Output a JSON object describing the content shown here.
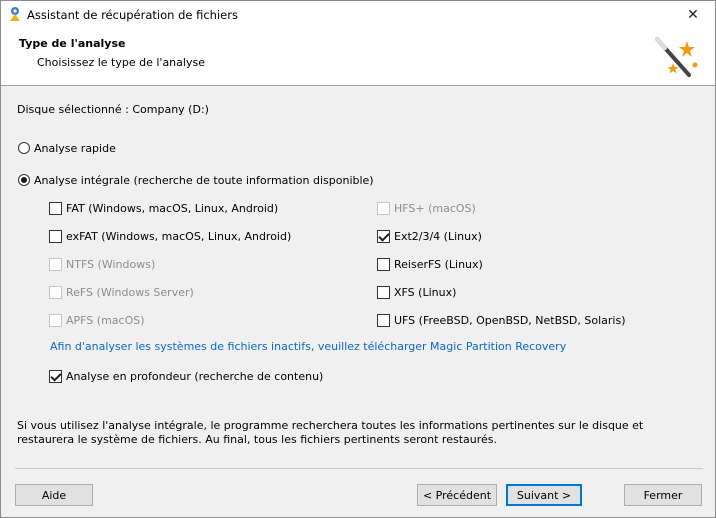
{
  "window": {
    "title": "Assistant de récupération de fichiers",
    "close_glyph": "✕"
  },
  "header": {
    "title": "Type de l'analyse",
    "subtitle": "Choisissez le type de l'analyse"
  },
  "disk": {
    "label": "Disque sélectionné : Company (D:)"
  },
  "scan_options": {
    "quick": {
      "label": "Analyse rapide",
      "selected": false
    },
    "full": {
      "label": "Analyse intégrale (recherche de toute information disponible)",
      "selected": true
    }
  },
  "filesystems_left": [
    {
      "label": "FAT (Windows, macOS, Linux, Android)",
      "checked": false,
      "enabled": true
    },
    {
      "label": "exFAT (Windows, macOS, Linux, Android)",
      "checked": false,
      "enabled": true
    },
    {
      "label": "NTFS (Windows)",
      "checked": false,
      "enabled": false
    },
    {
      "label": "ReFS (Windows Server)",
      "checked": false,
      "enabled": false
    },
    {
      "label": "APFS (macOS)",
      "checked": false,
      "enabled": false
    }
  ],
  "filesystems_right": [
    {
      "label": "HFS+ (macOS)",
      "checked": false,
      "enabled": false
    },
    {
      "label": "Ext2/3/4 (Linux)",
      "checked": true,
      "enabled": true
    },
    {
      "label": "ReiserFS (Linux)",
      "checked": false,
      "enabled": true
    },
    {
      "label": "XFS (Linux)",
      "checked": false,
      "enabled": true
    },
    {
      "label": "UFS (FreeBSD, OpenBSD, NetBSD, Solaris)",
      "checked": false,
      "enabled": true
    }
  ],
  "link": {
    "text": "Afin d'analyser les systèmes de fichiers inactifs, veuillez télécharger Magic Partition Recovery"
  },
  "deep_scan": {
    "label": "Analyse en profondeur (recherche de contenu)",
    "checked": true
  },
  "info_text": "Si vous utilisez l'analyse intégrale, le programme recherchera toutes les informations pertinentes sur le disque et restaurera le système de fichiers. Au final, tous les fichiers pertinents seront restaurés.",
  "buttons": {
    "help": "Aide",
    "previous": "< Précédent",
    "next": "Suivant >",
    "close": "Fermer"
  },
  "colors": {
    "link": "#0b68c4",
    "default_button_border": "#0078d7",
    "disabled_text": "#8d8d8d"
  }
}
